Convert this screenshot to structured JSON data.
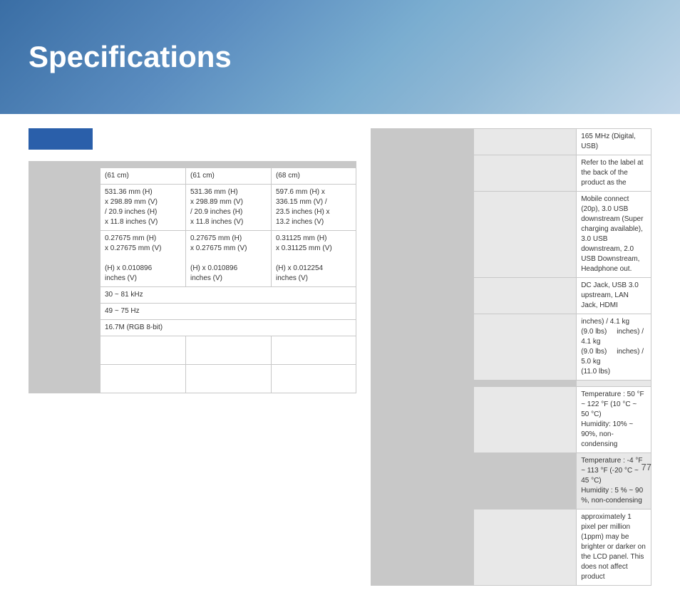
{
  "header": {
    "title": "Specifications",
    "background": "blue gradient"
  },
  "left_table": {
    "columns": [
      "",
      "(61 cm)",
      "(61 cm)",
      "(68 cm)"
    ],
    "rows": [
      {
        "header": "",
        "cells": [
          "(61 cm)",
          "(61 cm)",
          "(68 cm)"
        ]
      },
      {
        "header": "",
        "cells": [
          "531.36 mm (H) x 298.89 mm (V) / 20.9 inches (H) x 11.8 inches (V)",
          "531.36 mm (H) x 298.89 mm (V) / 20.9 inches (H) x 11.8 inches (V)",
          "597.6 mm (H) x 336.15 mm (V) / 23.5 inches (H) x 13.2 inches (V)"
        ]
      },
      {
        "header": "",
        "cells": [
          "0.27675 mm (H) x 0.27675 mm (V)\n(H) x 0.010896 inches (V)",
          "0.27675 mm (H) x 0.27675 mm (V)\n(H) x 0.010896 inches (V)",
          "0.31125 mm (H) x 0.31125 mm (V)\n(H) x 0.012254 inches (V)"
        ]
      },
      {
        "header": "",
        "cells": [
          "30 ~ 81 kHz",
          "",
          ""
        ]
      },
      {
        "header": "",
        "cells": [
          "49 ~ 75 Hz",
          "",
          ""
        ]
      },
      {
        "header": "",
        "cells": [
          "16.7M (RGB 8-bit)",
          "",
          ""
        ]
      }
    ],
    "empty_rows": 2
  },
  "right_table": {
    "rows": [
      {
        "label": "",
        "sublabel": "",
        "value": "165 MHz (Digital, USB)"
      },
      {
        "label": "",
        "sublabel": "",
        "value": "Refer to the label at the back of the product as the"
      },
      {
        "label": "",
        "sublabel": "",
        "value": "Mobile connect (20p), 3.0 USB downstream (Super charging available), 3.0 USB downstream, 2.0 USB Downstream, Headphone out."
      },
      {
        "label": "",
        "sublabel": "",
        "value": "DC Jack, USB 3.0 upstream, LAN Jack, HDMI"
      },
      {
        "label": "",
        "sublabel": "inches) / 4.1 kg (9.0 lbs)",
        "sublabel2": "inches) / 4.1 kg (9.0 lbs)",
        "sublabel3": "inches) / 5.0 kg (11.0 lbs)"
      },
      {
        "label": "",
        "sublabel": "",
        "value": "Temperature : 50 °F ~ 122 °F (10 °C ~ 50 °C)\nHumidity: 10% ~ 90%, non-condensing"
      },
      {
        "label": "",
        "sublabel": "",
        "value": "Temperature : -4 °F ~ 113 °F (-20 °C ~ 45 °C)\nHumidity : 5 % ~ 90 %, non-condensing"
      },
      {
        "label": "",
        "sublabel": "",
        "value": "approximately 1 pixel per million (1ppm) may be brighter or darker on the LCD panel. This does not affect product"
      }
    ]
  },
  "page": {
    "number": "77"
  }
}
